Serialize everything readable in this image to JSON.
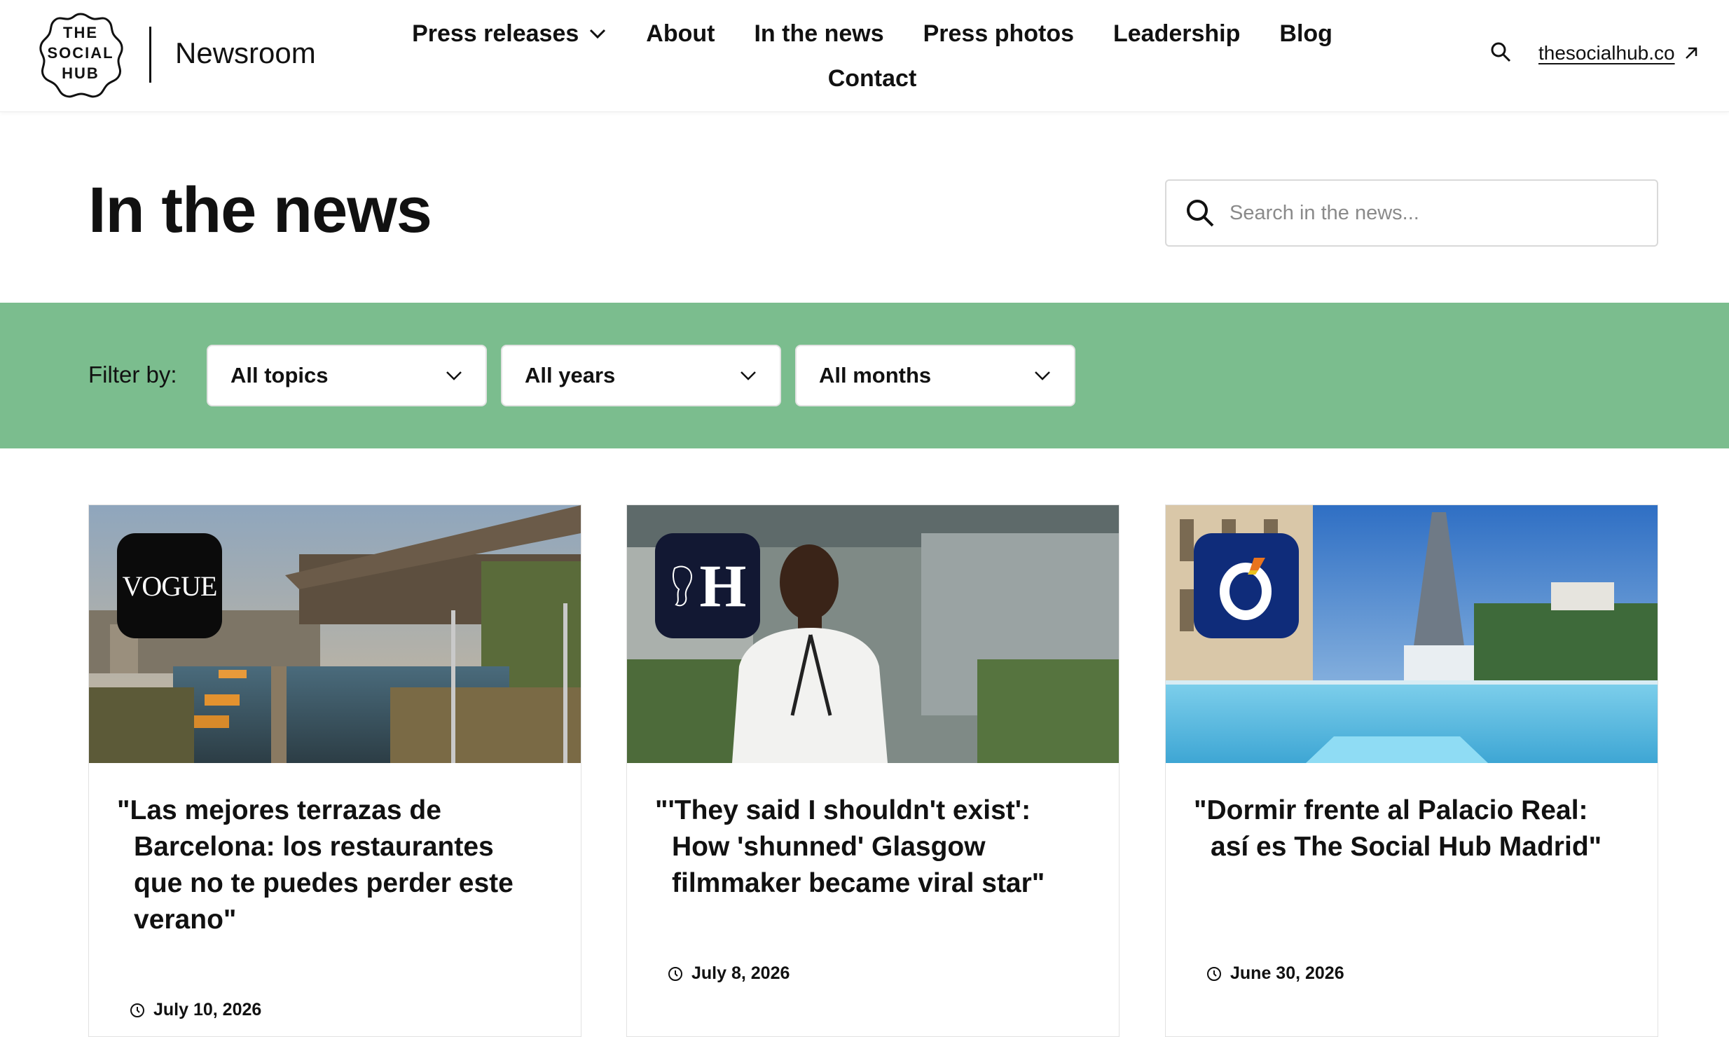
{
  "header": {
    "logo_text": [
      "THE",
      "SOCIAL",
      "HUB"
    ],
    "brand": "Newsroom",
    "nav": [
      {
        "label": "Press releases",
        "has_dropdown": true
      },
      {
        "label": "About"
      },
      {
        "label": "In the news"
      },
      {
        "label": "Press photos"
      },
      {
        "label": "Leadership"
      },
      {
        "label": "Blog"
      },
      {
        "label": "Contact"
      }
    ],
    "external_link": "thesocialhub.co"
  },
  "page": {
    "title": "In the news",
    "search_placeholder": "Search in the news..."
  },
  "filters": {
    "label": "Filter by:",
    "topics": "All topics",
    "years": "All years",
    "months": "All months"
  },
  "articles": [
    {
      "publication": "VOGUE",
      "title": "\"Las mejores terrazas de Barcelona: los restaurantes que no te puedes perder este verano\"",
      "date": "July 10, 2026"
    },
    {
      "publication": "H",
      "title": "\"'They said I shouldn't exist': How 'shunned' Glasgow filmmaker became viral star\"",
      "date": "July 8, 2026"
    },
    {
      "publication": "O",
      "title": "\"Dormir frente al Palacio Real: así es The Social Hub Madrid\"",
      "date": "June 30, 2026"
    }
  ],
  "colors": {
    "filter_bar": "#7bbd8e",
    "vogue_badge": "#0b0b0b",
    "herald_badge": "#121833",
    "okdiario_badge": "#0f2c7a"
  }
}
